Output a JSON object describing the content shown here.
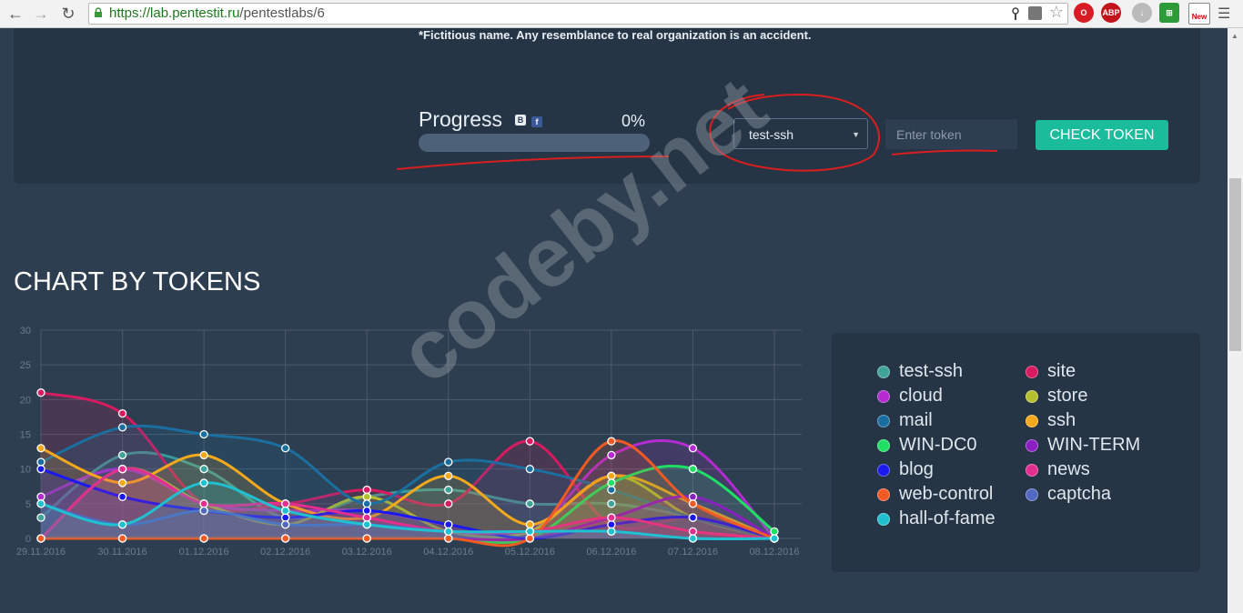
{
  "browser": {
    "url_host": "https://lab.pentestit.ru",
    "url_path": "/pentestlabs/6"
  },
  "panel": {
    "fictitious_note": "*Fictitious name. Any resemblance to real organization is an accident.",
    "progress_label": "Progress",
    "progress_percent_text": "0%",
    "progress_value": 0,
    "selected_lab": "test-ssh",
    "token_placeholder": "Enter token",
    "check_button": "CHECK TOKEN"
  },
  "chart_title": "CHART BY TOKENS",
  "watermark": "codeby.net",
  "colors": {
    "accent": "#1abc9c",
    "page_bg": "#2d3e50",
    "panel_bg": "#253545"
  },
  "chart_data": {
    "type": "line",
    "ylim": [
      0,
      30
    ],
    "yticks": [
      0,
      5,
      10,
      15,
      20,
      25,
      30
    ],
    "categories": [
      "29.11.2016",
      "30.11.2016",
      "01.12.2016",
      "02.12.2016",
      "03.12.2016",
      "04.12.2016",
      "05.12.2016",
      "06.12.2016",
      "07.12.2016",
      "08.12.2016"
    ],
    "series": [
      {
        "name": "test-ssh",
        "color": "#3fa39a",
        "values": [
          3,
          12,
          10,
          3,
          6,
          7,
          5,
          5,
          3,
          0
        ]
      },
      {
        "name": "site",
        "color": "#d81b60",
        "values": [
          21,
          18,
          5,
          5,
          7,
          5,
          14,
          2,
          3,
          0
        ]
      },
      {
        "name": "cloud",
        "color": "#b32bd1",
        "values": [
          6,
          10,
          5,
          4,
          4,
          2,
          1,
          12,
          13,
          0
        ]
      },
      {
        "name": "store",
        "color": "#b5c02f",
        "values": [
          0,
          10,
          5,
          2,
          6,
          1,
          1,
          9,
          3,
          0
        ]
      },
      {
        "name": "mail",
        "color": "#1b6fa0",
        "values": [
          11,
          16,
          15,
          13,
          5,
          11,
          10,
          7,
          3,
          0
        ]
      },
      {
        "name": "ssh",
        "color": "#f4a81c",
        "values": [
          13,
          8,
          12,
          5,
          3,
          9,
          2,
          9,
          5,
          0
        ]
      },
      {
        "name": "WIN-DC0",
        "color": "#1fe064",
        "values": [
          0,
          0,
          0,
          0,
          0,
          0,
          0,
          8,
          10,
          1
        ]
      },
      {
        "name": "WIN-TERM",
        "color": "#8a1fc2",
        "values": [
          0,
          0,
          0,
          0,
          0,
          0,
          0,
          3,
          6,
          0
        ]
      },
      {
        "name": "blog",
        "color": "#1a1aee",
        "values": [
          10,
          6,
          4,
          3,
          4,
          2,
          0,
          2,
          3,
          0
        ]
      },
      {
        "name": "news",
        "color": "#e22f8f",
        "values": [
          0,
          10,
          5,
          5,
          3,
          1,
          1,
          3,
          1,
          0
        ]
      },
      {
        "name": "web-control",
        "color": "#f15a24",
        "values": [
          0,
          0,
          0,
          0,
          0,
          0,
          0,
          14,
          5,
          0
        ]
      },
      {
        "name": "captcha",
        "color": "#5468c2",
        "values": [
          5,
          2,
          4,
          2,
          2,
          1,
          1,
          1,
          0,
          0
        ]
      },
      {
        "name": "hall-of-fame",
        "color": "#1fc1d0",
        "values": [
          5,
          2,
          8,
          4,
          2,
          1,
          1,
          1,
          0,
          0
        ]
      }
    ]
  }
}
